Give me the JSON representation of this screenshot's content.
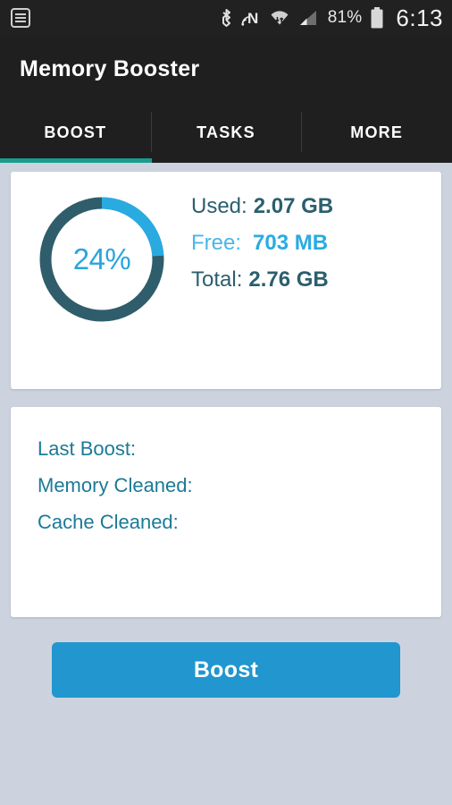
{
  "statusbar": {
    "left_icon": "list-icon",
    "icons": [
      "bluetooth-icon",
      "nfc-icon",
      "wifi-icon",
      "cellular-signal-icon"
    ],
    "battery_percent": "81%",
    "battery_icon": "battery-icon",
    "time": "6:13"
  },
  "header": {
    "title": "Memory Booster"
  },
  "tabs": [
    {
      "label": "BOOST",
      "active": true
    },
    {
      "label": "TASKS",
      "active": false
    },
    {
      "label": "MORE",
      "active": false
    }
  ],
  "memory_card": {
    "percent_label": "24%",
    "rows": [
      {
        "key": "Used:",
        "value": "2.07 GB"
      },
      {
        "key": "Free:",
        "value": "703 MB"
      },
      {
        "key": "Total:",
        "value": "2.76 GB"
      }
    ]
  },
  "stats_card": {
    "rows": [
      {
        "label": "Last Boost:",
        "value": ""
      },
      {
        "label": "Memory Cleaned:",
        "value": ""
      },
      {
        "label": "Cache Cleaned:",
        "value": ""
      }
    ]
  },
  "boost_button": {
    "label": "Boost"
  },
  "chart_data": {
    "type": "pie",
    "title": "Memory Usage",
    "categories": [
      "Used",
      "Free"
    ],
    "values": [
      24,
      76
    ],
    "value_labels": [
      "2.07 GB",
      "703 MB"
    ],
    "total": "2.76 GB",
    "center_label": "24%",
    "colors": [
      "#29abe2",
      "#2f5d6b"
    ],
    "start_angle": 90,
    "direction": "clockwise",
    "donut": true
  },
  "colors": {
    "accent_blue": "#29abe2",
    "button_blue": "#2196cf",
    "dark_teal": "#2f5d6b",
    "tab_underline_teal": "#1a9b8c",
    "header_dark": "#1f1f1f",
    "page_background": "#ccd3de",
    "card_white": "#ffffff"
  }
}
